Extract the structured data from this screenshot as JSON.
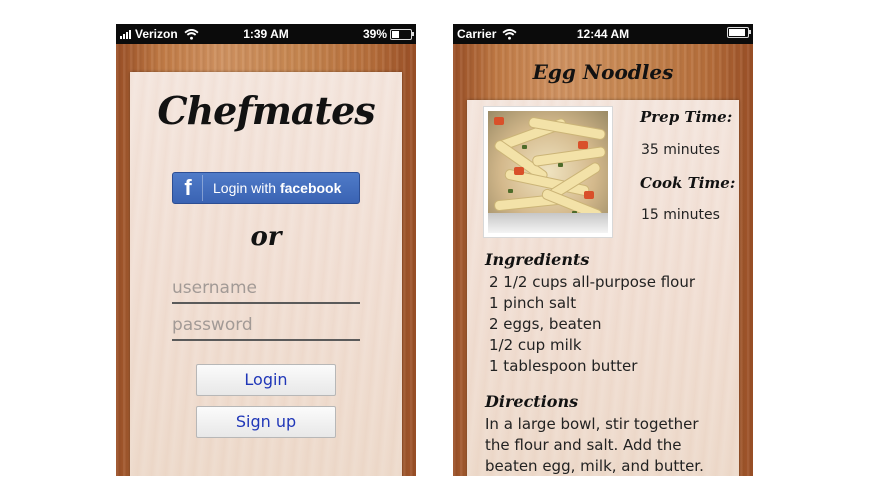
{
  "login_screen": {
    "status_bar": {
      "carrier": "Verizon",
      "time": "1:39 AM",
      "battery": "39%"
    },
    "app_title": "Chefmates",
    "facebook_button": {
      "prefix": "Login with ",
      "brand": "facebook",
      "logo": "f"
    },
    "or_text": "or",
    "username_placeholder": "username",
    "password_placeholder": "password",
    "login_button": "Login",
    "signup_button": "Sign up"
  },
  "recipe_screen": {
    "status_bar": {
      "carrier": "Carrier",
      "time": "12:44 AM"
    },
    "title": "Egg Noodles",
    "prep_time_label": "Prep Time:",
    "prep_time_value": "35 minutes",
    "cook_time_label": "Cook Time:",
    "cook_time_value": "15 minutes",
    "ingredients_heading": "Ingredients",
    "ingredients": [
      "2 1/2 cups all-purpose flour",
      "1 pinch salt",
      "2 eggs, beaten",
      "1/2 cup milk",
      "1 tablespoon butter"
    ],
    "directions_heading": "Directions",
    "directions_text": "In a large bowl, stir together the flour and salt. Add the beaten egg, milk, and butter. Knead dough until"
  }
}
